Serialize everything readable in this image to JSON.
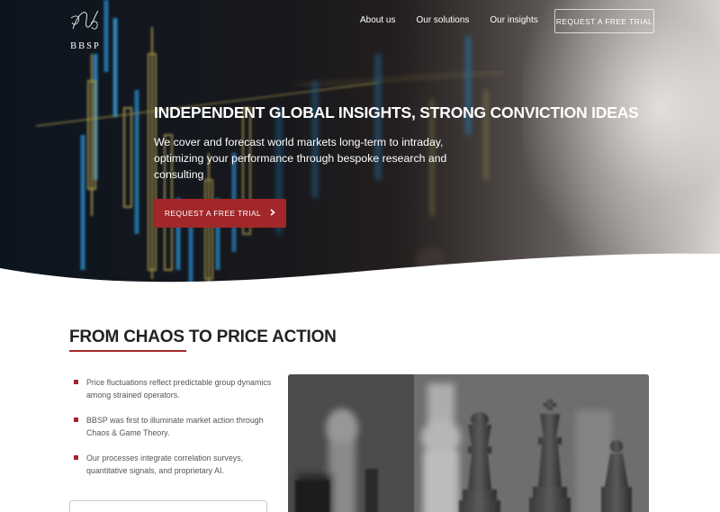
{
  "brand": {
    "logo_text": "BBSP"
  },
  "nav": {
    "items": [
      {
        "label": "About us"
      },
      {
        "label": "Our solutions"
      },
      {
        "label": "Our insights"
      }
    ],
    "cta_label": "REQUEST A FREE TRIAL"
  },
  "hero": {
    "title": "INDEPENDENT GLOBAL INSIGHTS, STRONG CONVICTION IDEAS",
    "subtitle": "We cover and forecast world markets long-term to intraday, optimizing your performance through bespoke research and consulting",
    "cta_label": "REQUEST A FREE TRIAL",
    "cta_icon": "chevron-right-icon"
  },
  "section": {
    "title": "FROM CHAOS TO PRICE ACTION",
    "bullets": [
      {
        "text": "Price fluctuations reflect predictable group dynamics among strained operators."
      },
      {
        "text": "BBSP was first to illuminate market action through Chaos & Game Theory."
      },
      {
        "text": "Our processes integrate correlation surveys, quantitative signals, and proprietary AI."
      }
    ]
  },
  "colors": {
    "accent": "#a1272a",
    "white": "#ffffff",
    "text": "#333333"
  }
}
